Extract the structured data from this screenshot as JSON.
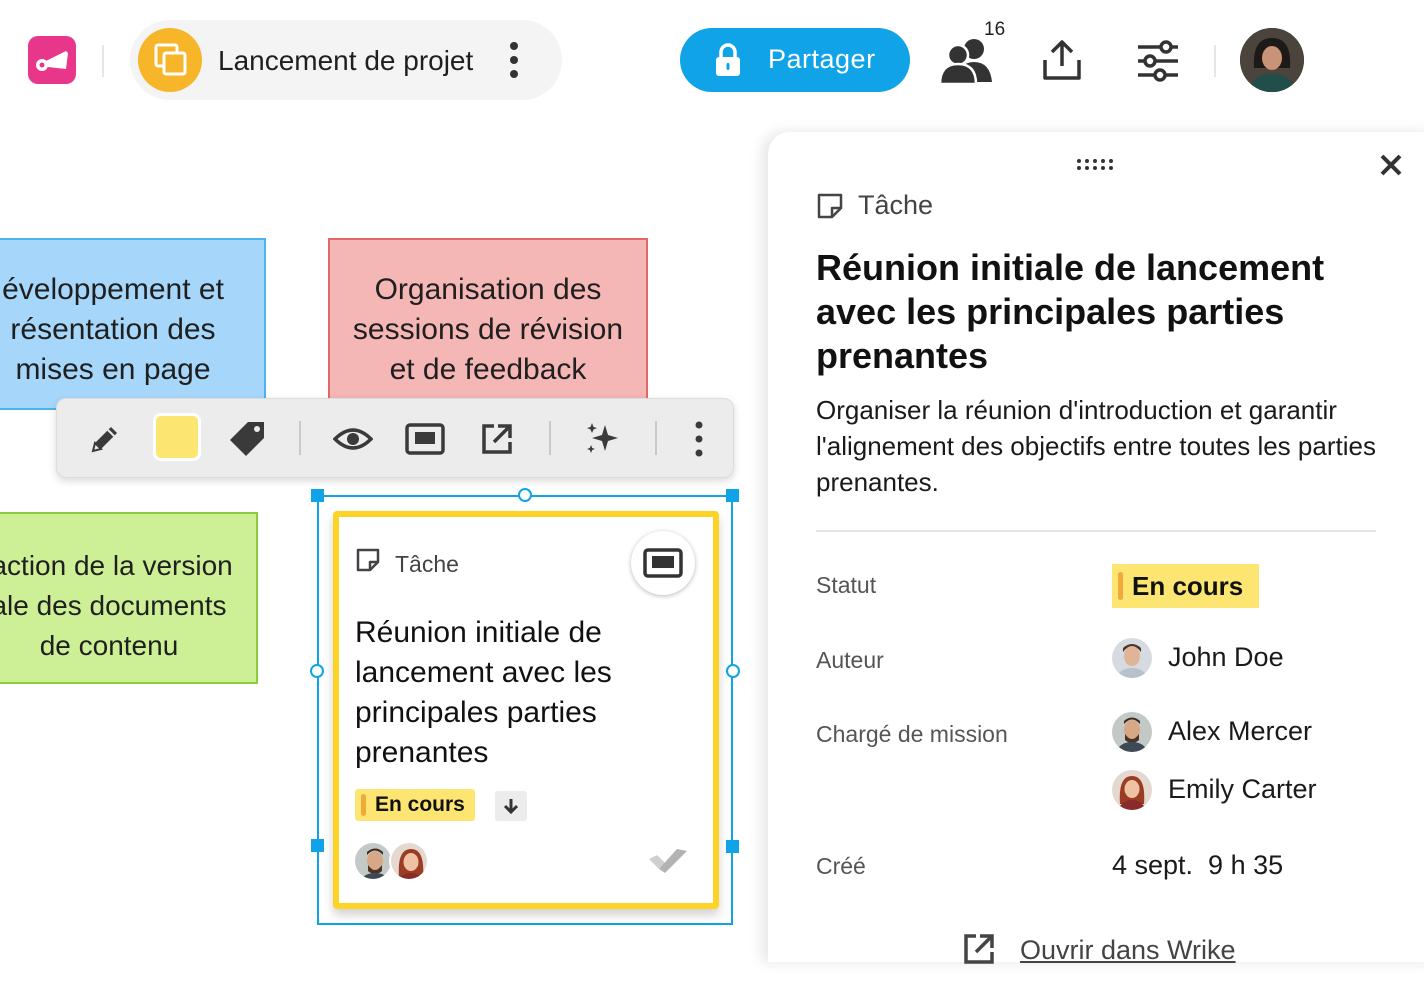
{
  "header": {
    "board_title": "Lancement de projet",
    "share_label": "Partager",
    "collaborators_count": "16"
  },
  "notes": [
    {
      "text": "éveloppement et\nrésentation des\nmises en page",
      "color": "#a6d7fa"
    },
    {
      "text": "Organisation des\nsessions de révision\net de feedback",
      "color": "#f5b6b6"
    },
    {
      "text": "laction de la version\nale des documents\nde contenu",
      "color": "#cdef96"
    }
  ],
  "toolbar": {
    "swatch_color": "#fde571"
  },
  "card": {
    "type_label": "Tâche",
    "title": "Réunion initiale de lancement avec les principales parties prenantes",
    "status": "En cours"
  },
  "panel": {
    "type_label": "Tâche",
    "title": "Réunion initiale de lancement avec les principales parties prenantes",
    "description": "Organiser la réunion d'introduction et garantir l'alignement des objectifs entre toutes les parties prenantes.",
    "status_label": "Statut",
    "status_value": "En cours",
    "author_label": "Auteur",
    "author_name": "John Doe",
    "assignee_label": "Chargé de mission",
    "assignees": [
      "Alex Mercer",
      "Emily Carter"
    ],
    "created_label": "Créé",
    "created_value": "4 sept.  9 h 35",
    "open_link": "Ouvrir dans Wrike"
  },
  "colors": {
    "accent_blue": "#10a3e8",
    "status_yellow": "#fde571",
    "logo_pink": "#e8378a",
    "board_icon_orange": "#f7b52a"
  }
}
